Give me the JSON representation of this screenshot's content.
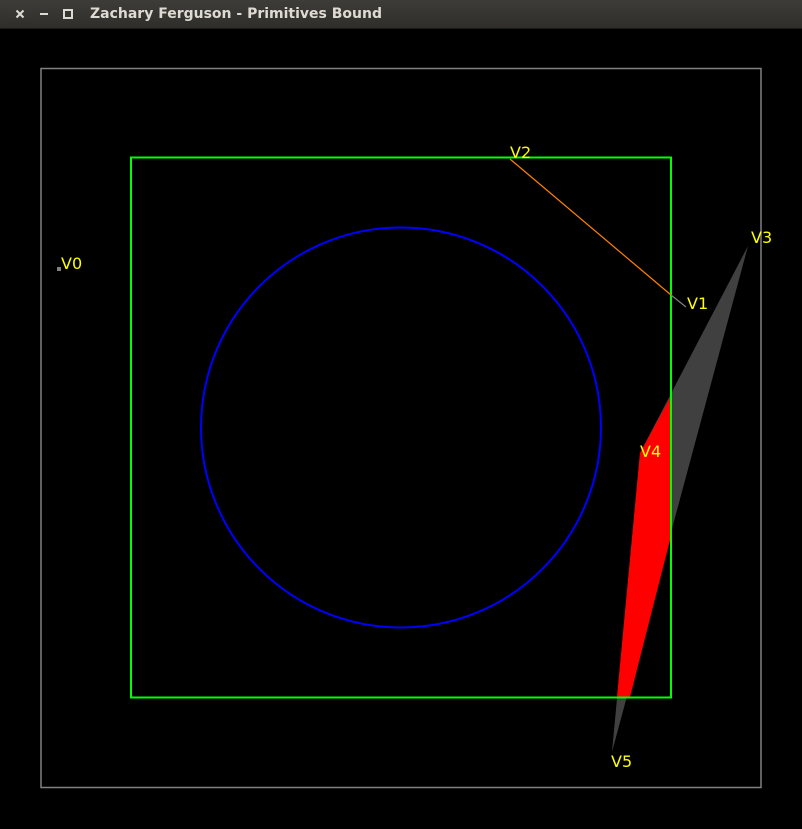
{
  "window": {
    "title": "Zachary Ferguson - Primitives Bound",
    "controls": {
      "close_icon": "close-icon",
      "minimize_icon": "minimize-icon",
      "maximize_icon": "maximize-icon"
    }
  },
  "scene": {
    "background_color": "#000000",
    "outer_bound_color": "#808080",
    "square_color": "#00ff00",
    "circle_color": "#0000ff",
    "line_color": "#ff8000",
    "triangle_color": "#404040",
    "clipped_fill_color": "#ff0000",
    "point_color": "#808080",
    "label_color": "#ffff00",
    "vertices": [
      "V0",
      "V1",
      "V2",
      "V3",
      "V4",
      "V5"
    ]
  }
}
